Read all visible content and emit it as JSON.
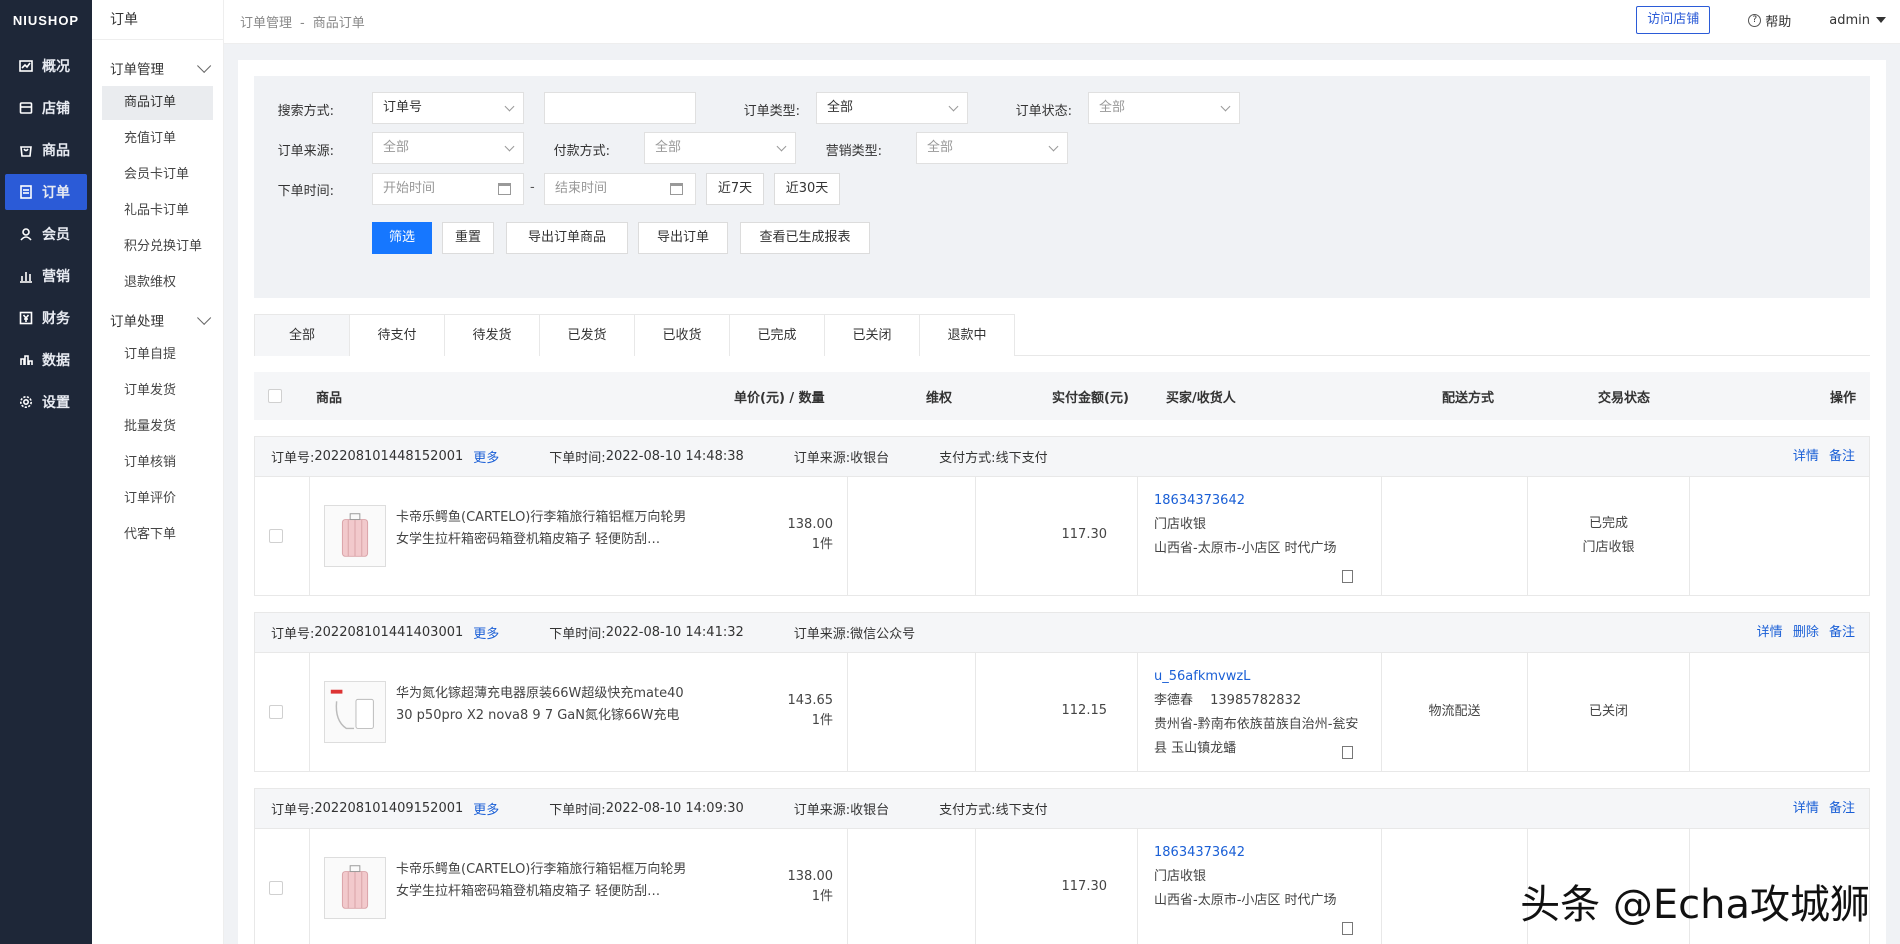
{
  "brand": "NIUSHOP",
  "nav": [
    {
      "label": "概况",
      "icon": "chart-icon"
    },
    {
      "label": "店铺",
      "icon": "store-icon"
    },
    {
      "label": "商品",
      "icon": "bag-icon"
    },
    {
      "label": "订单",
      "icon": "order-icon"
    },
    {
      "label": "会员",
      "icon": "user-icon"
    },
    {
      "label": "营销",
      "icon": "bars-icon"
    },
    {
      "label": "财务",
      "icon": "finance-icon"
    },
    {
      "label": "数据",
      "icon": "data-icon"
    },
    {
      "label": "设置",
      "icon": "gear-icon"
    }
  ],
  "subnav": {
    "title": "订单",
    "groups": [
      {
        "title": "订单管理",
        "items": [
          "商品订单",
          "充值订单",
          "会员卡订单",
          "礼品卡订单",
          "积分兑换订单",
          "退款维权"
        ]
      },
      {
        "title": "订单处理",
        "items": [
          "订单自提",
          "订单发货",
          "批量发货",
          "订单核销",
          "订单评价",
          "代客下单"
        ]
      }
    ]
  },
  "topbar": {
    "crumb1": "订单管理",
    "crumb_sep": "-",
    "crumb2": "商品订单",
    "visit_store": "访问店铺",
    "help": "帮助",
    "user": "admin"
  },
  "filter": {
    "search_label": "搜索方式:",
    "search_value": "订单号",
    "keyword_value": "",
    "order_type_label": "订单类型:",
    "order_type_value": "全部",
    "order_status_label": "订单状态:",
    "order_status_value": "全部",
    "source_label": "订单来源:",
    "source_value": "全部",
    "pay_label": "付款方式:",
    "pay_value": "全部",
    "marketing_label": "营销类型:",
    "marketing_value": "全部",
    "time_label": "下单时间:",
    "start_placeholder": "开始时间",
    "time_sep": "-",
    "end_placeholder": "结束时间",
    "last7": "近7天",
    "last30": "近30天",
    "btn_filter": "筛选",
    "btn_reset": "重置",
    "btn_export_goods": "导出订单商品",
    "btn_export": "导出订单",
    "btn_reports": "查看已生成报表"
  },
  "tabs": [
    "全部",
    "待支付",
    "待发货",
    "已发货",
    "已收货",
    "已完成",
    "已关闭",
    "退款中"
  ],
  "table_header": {
    "goods": "商品",
    "price_qty": "单价(元) / 数量",
    "rights": "维权",
    "paid": "实付金额(元)",
    "buyer": "买家/收货人",
    "delivery": "配送方式",
    "status": "交易状态",
    "actions": "操作"
  },
  "orders": [
    {
      "no_label": "订单号:",
      "no": "202208101448152001",
      "more": "更多",
      "time_label": "下单时间:",
      "time": "2022-08-10 14:48:38",
      "source_label": "订单来源:",
      "source": "收银台",
      "pay_label": "支付方式:",
      "pay": "线下支付",
      "actions": [
        "详情",
        "备注"
      ],
      "goods": "卡帝乐鳄鱼(CARTELO)行李箱旅行箱铝框万向轮男女学生拉杆箱密码箱登机箱皮箱子 轻便防刮…",
      "price": "138.00",
      "qty": "1件",
      "paid": "117.30",
      "buyer_name": "18634373642",
      "buyer_line2": "门店收银",
      "buyer_addr": "山西省-太原市-小店区 时代广场",
      "delivery": "",
      "status1": "已完成",
      "status2": "门店收银"
    },
    {
      "no_label": "订单号:",
      "no": "202208101441403001",
      "more": "更多",
      "time_label": "下单时间:",
      "time": "2022-08-10 14:41:32",
      "source_label": "订单来源:",
      "source": "微信公众号",
      "pay_label": "",
      "pay": "",
      "actions": [
        "详情",
        "删除",
        "备注"
      ],
      "goods": "华为氮化镓超薄充电器原装66W超级快充mate40 30 p50pro X2 nova8 9 7 GaN氮化镓66W充电",
      "price": "143.65",
      "qty": "1件",
      "paid": "112.15",
      "buyer_name": "u_56afkmvwzL",
      "buyer_line2": "李德春　 13985782832",
      "buyer_addr": "贵州省-黔南布依族苗族自治州-瓮安县 玉山镇龙蟠",
      "delivery": "物流配送",
      "status1": "已关闭",
      "status2": ""
    },
    {
      "no_label": "订单号:",
      "no": "202208101409152001",
      "more": "更多",
      "time_label": "下单时间:",
      "time": "2022-08-10 14:09:30",
      "source_label": "订单来源:",
      "source": "收银台",
      "pay_label": "支付方式:",
      "pay": "线下支付",
      "actions": [
        "详情",
        "备注"
      ],
      "goods": "卡帝乐鳄鱼(CARTELO)行李箱旅行箱铝框万向轮男女学生拉杆箱密码箱登机箱皮箱子 轻便防刮…",
      "price": "138.00",
      "qty": "1件",
      "paid": "117.30",
      "buyer_name": "18634373642",
      "buyer_line2": "门店收银",
      "buyer_addr": "山西省-太原市-小店区 时代广场",
      "delivery": "",
      "status1": "",
      "status2": ""
    }
  ],
  "watermark": "头条 @Echa攻城狮"
}
